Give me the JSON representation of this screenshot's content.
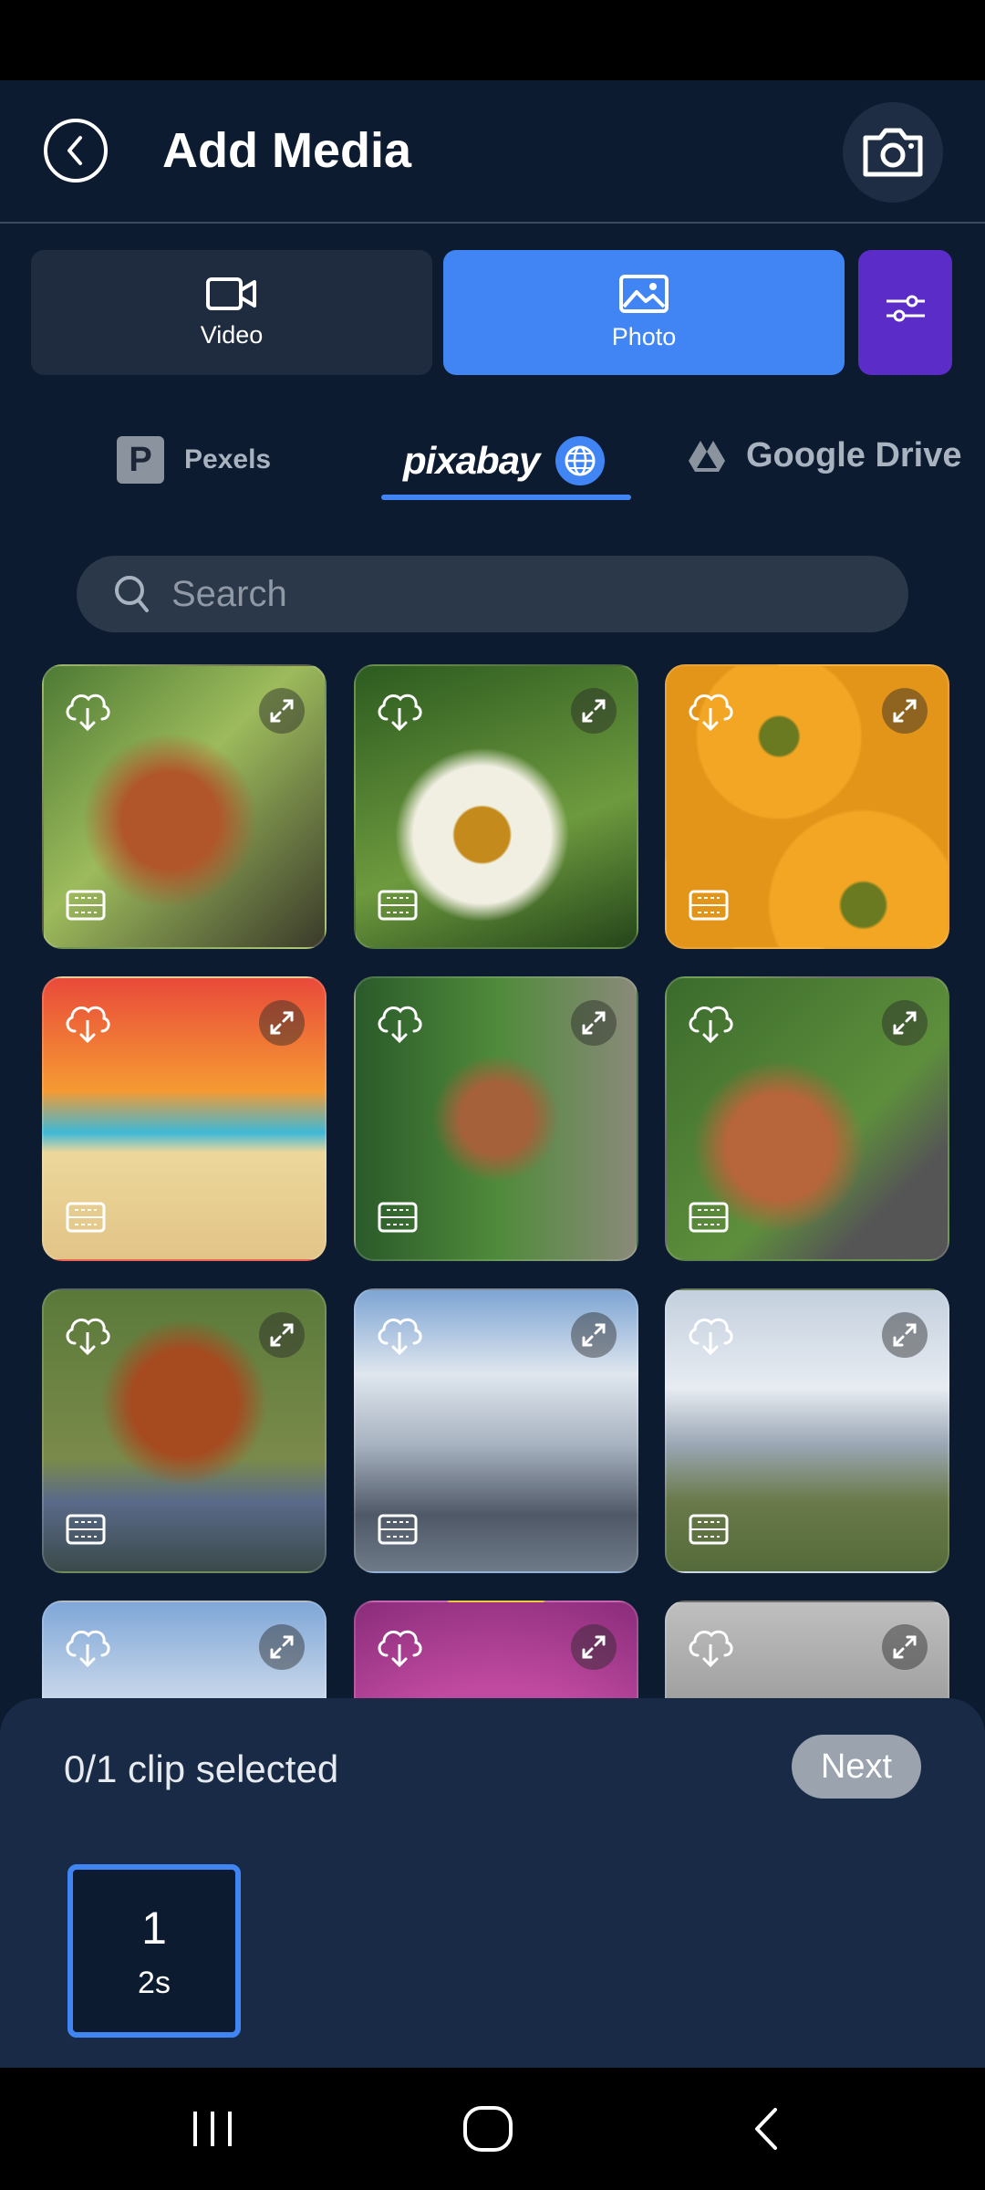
{
  "header": {
    "title": "Add Media"
  },
  "media_types": [
    {
      "label": "Video",
      "icon": "video-camera-icon",
      "selected": false
    },
    {
      "label": "Photo",
      "icon": "image-icon",
      "selected": true
    }
  ],
  "sources": [
    {
      "label": "Pexels",
      "logo": "P"
    },
    {
      "label": "pixabay",
      "selected": true
    },
    {
      "label": "Google Drive"
    }
  ],
  "search": {
    "placeholder": "Search"
  },
  "grid": {
    "tiles": [
      "squirrel",
      "bee-on-flower",
      "yellow-flowers",
      "beach-illustration",
      "squirrel-birdhouse",
      "squirrel-feeder",
      "squirrel-drinking",
      "snowy-mountains",
      "glacier-valley",
      "mountain-clouds",
      "pink-flower",
      "foggy-birds"
    ]
  },
  "selection": {
    "status": "0/1 clip selected",
    "next_label": "Next",
    "slot_number": "1",
    "slot_duration": "2s"
  },
  "colors": {
    "accent": "#4185f4",
    "filter": "#5b2cc8",
    "background": "#0c1b30"
  }
}
